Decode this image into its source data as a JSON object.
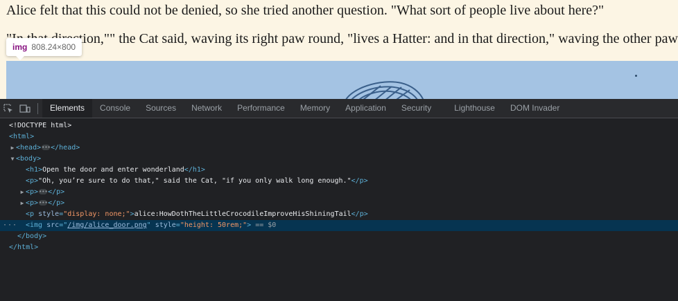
{
  "page": {
    "para1": "Alice felt that this could not be denied, so she tried another question. \"What sort of people live about here?\"",
    "para2": "\"In that direction,\"\" the Cat said, waving its right paw round, \"lives a Hatter: and in that direction,\" waving the other paw"
  },
  "tooltip": {
    "tag": "img",
    "dims": "808.24×800"
  },
  "devtools": {
    "tabs": [
      "Elements",
      "Console",
      "Sources",
      "Network",
      "Performance",
      "Memory",
      "Application",
      "Security",
      "Lighthouse",
      "DOM Invader"
    ],
    "active_tab": "Elements",
    "dom": {
      "doctype": "<!DOCTYPE html>",
      "html_open": "<html>",
      "head_open": "<head>",
      "head_close": "</head>",
      "body_open": "<body>",
      "h1_open": "<h1>",
      "h1_text": "Open the door and enter wonderland",
      "h1_close": "</h1>",
      "p_open": "<p>",
      "p_close": "</p>",
      "p_text": "\"Oh, you’re sure to do that,\" said the Cat, \"if you only walk long enough.\"",
      "p_hidden_tag": "<p",
      "p_hidden_attr": "style",
      "p_hidden_value": "\"display: none;\"",
      "p_hidden_text": "alice:HowDothTheLittleCrocodileImproveHisShiningTail",
      "img_tag": "<img",
      "img_src_attr": "src",
      "img_src_value": "/img/alice_door.png",
      "img_style_attr": "style",
      "img_style_value": "\"height: 50rem;\"",
      "img_eq": "== $0",
      "body_close": "</body>",
      "html_close": "</html>"
    }
  }
}
